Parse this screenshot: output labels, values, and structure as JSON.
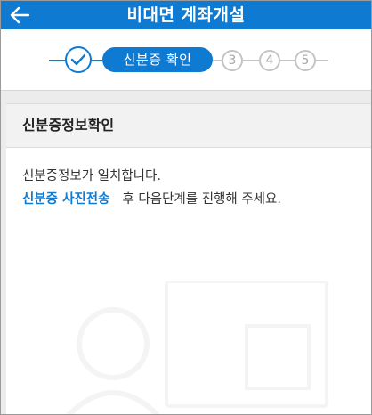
{
  "header": {
    "title": "비대면 계좌개설",
    "back_icon": "arrow-left-icon"
  },
  "stepper": {
    "done_icon": "check-icon",
    "active_label": "신분증 확인",
    "steps": [
      "3",
      "4",
      "5"
    ]
  },
  "section": {
    "title": "신분증정보확인",
    "message_line1": "신분증정보가 일치합니다.",
    "highlight": "신분증 사진전송",
    "message_line2_rest": "후 다음단계를 진행해 주세요."
  },
  "colors": {
    "primary": "#0f7ad1",
    "inactive": "#c4c4c4"
  }
}
